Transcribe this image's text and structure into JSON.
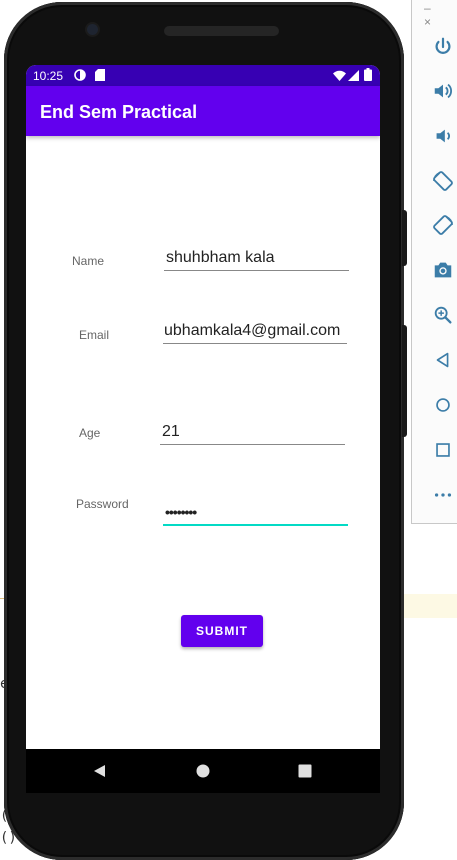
{
  "status_bar": {
    "time": "10:25"
  },
  "app_bar": {
    "title": "End Sem Practical"
  },
  "form": {
    "name_label": "Name",
    "name_value": "shuhbham kala",
    "email_label": "Email",
    "email_value": "ubhamkala4@gmail.com",
    "age_label": "Age",
    "age_value": "21",
    "password_label": "Password",
    "password_value": "••••••••",
    "submit_label": "SUBMIT"
  },
  "ide_fragments": {
    "left_e": "e",
    "left_paren": "(",
    "left_parens": "()",
    "left_brace": "()"
  },
  "emulator_toolbar": {
    "top_controls": "– ×",
    "buttons": [
      "power-icon",
      "volume-up-icon",
      "volume-down-icon",
      "rotate-left-icon",
      "rotate-right-icon",
      "camera-icon",
      "zoom-icon",
      "back-icon",
      "home-icon",
      "overview-icon",
      "more-icon"
    ]
  },
  "colors": {
    "primary": "#6200ee",
    "primary_dark": "#3700b3",
    "accent": "#03dac5"
  }
}
